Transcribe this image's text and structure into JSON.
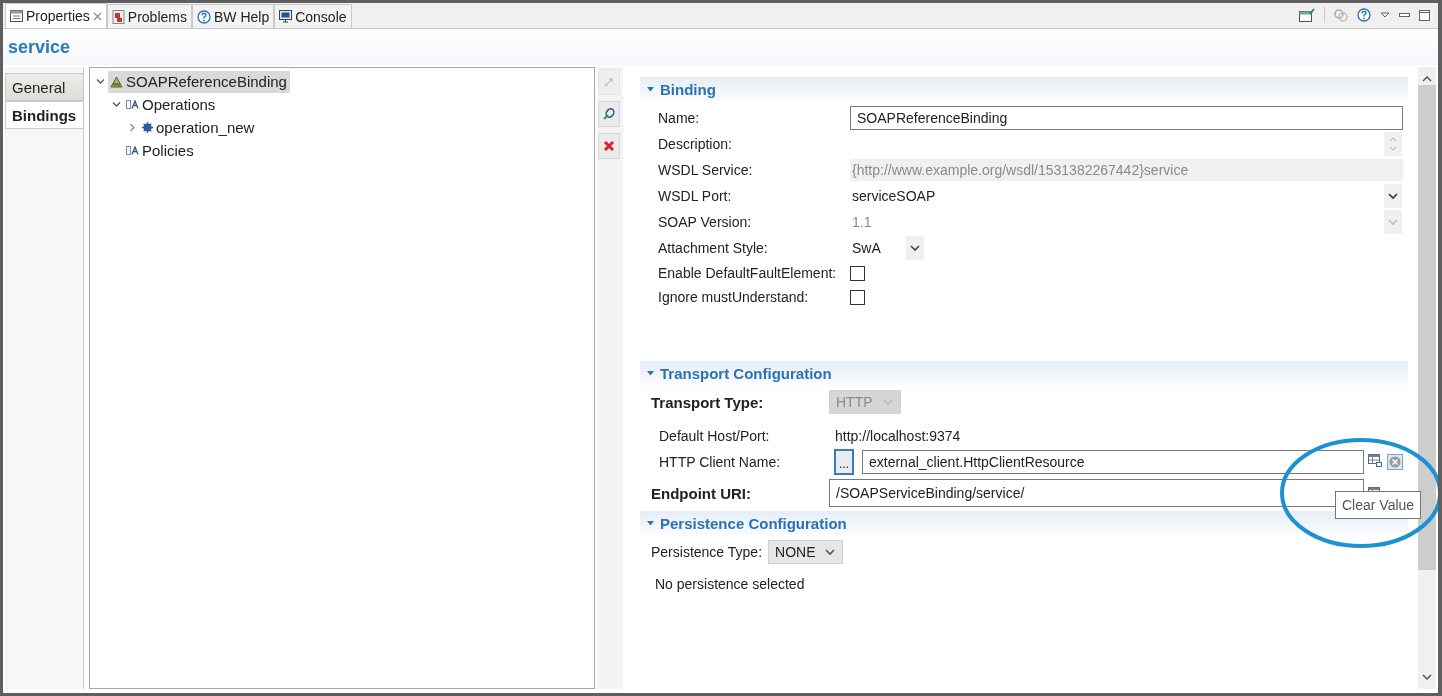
{
  "tabs": [
    {
      "label": "Properties",
      "selected": true,
      "closable": true
    },
    {
      "label": "Problems",
      "selected": false,
      "closable": false
    },
    {
      "label": "BW Help",
      "selected": false,
      "closable": false
    },
    {
      "label": "Console",
      "selected": false,
      "closable": false
    }
  ],
  "title": "service",
  "side_tabs": [
    {
      "label": "General",
      "selected": false
    },
    {
      "label": "Bindings",
      "selected": true
    }
  ],
  "tree": [
    {
      "label": "SOAPReferenceBinding",
      "expanded": true,
      "selected": true,
      "children": [
        {
          "label": "Operations",
          "expanded": true,
          "selected": false,
          "children": [
            {
              "label": "operation_new",
              "expanded": false,
              "selected": false
            }
          ]
        },
        {
          "label": "Policies",
          "selected": false
        }
      ]
    }
  ],
  "tool_buttons": [
    {
      "disabled": true
    },
    {
      "disabled": false
    },
    {
      "disabled": false
    }
  ],
  "sections": [
    {
      "title": "Binding",
      "expanded": true,
      "fields": [
        {
          "label": "Name:",
          "kind": "text",
          "value": "SOAPReferenceBinding",
          "disabled": false
        },
        {
          "label": "Description:",
          "kind": "textarea",
          "disabled": false
        },
        {
          "label": "WSDL Service:",
          "kind": "readonly",
          "value": "{http://www.example.org/wsdl/1531382267442}service",
          "disabled": true
        },
        {
          "label": "WSDL Port:",
          "kind": "select",
          "value": "serviceSOAP",
          "disabled": false
        },
        {
          "label": "SOAP Version:",
          "kind": "select",
          "value": "1.1",
          "disabled": true
        },
        {
          "label": "Attachment Style:",
          "kind": "combo",
          "value": "SwA",
          "disabled": false
        },
        {
          "label": "Enable DefaultFaultElement:",
          "kind": "checkbox",
          "checked": false,
          "disabled": false
        },
        {
          "label": "Ignore mustUnderstand:",
          "kind": "checkbox",
          "checked": false,
          "disabled": false
        }
      ]
    },
    {
      "title": "Transport Configuration",
      "expanded": true,
      "fields": [
        {
          "label": "Transport Type:",
          "kind": "selectbox",
          "value": "HTTP",
          "disabled": true,
          "emphasized": true
        },
        {
          "label": "Default Host/Port:",
          "kind": "static",
          "value": "http://localhost:9374",
          "disabled": false,
          "emphasized": false
        },
        {
          "label": "HTTP Client Name:",
          "kind": "resource",
          "browse": "...",
          "value": "external_client.HttpClientResource",
          "disabled": false,
          "emphasized": false
        },
        {
          "label": "Endpoint URI:",
          "kind": "uri",
          "value": "/SOAPServiceBinding/service/",
          "disabled": false,
          "emphasized": true
        }
      ]
    },
    {
      "title": "Persistence Configuration",
      "expanded": true,
      "fields": [
        {
          "label": "Persistence Type:",
          "kind": "selectbox",
          "value": "NONE",
          "disabled": false
        },
        {
          "kind": "note",
          "value": "No persistence selected"
        }
      ]
    }
  ],
  "tooltip": {
    "text": "Clear Value"
  }
}
